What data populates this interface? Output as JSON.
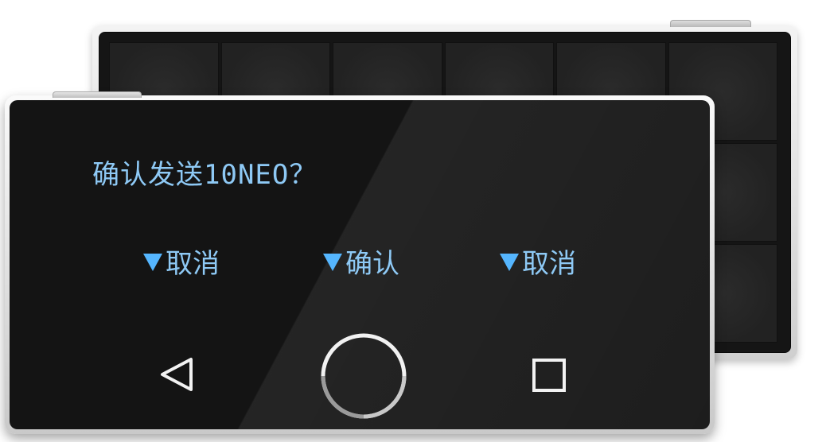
{
  "screen": {
    "prompt": "确认发送10NEO？"
  },
  "softkeys": {
    "left_label": "取消",
    "center_label": "确认",
    "right_label": "取消",
    "indicator_icon": "down-triangle-icon",
    "indicator_color": "#55b6ff",
    "text_color": "#8ec9f5"
  },
  "navbar": {
    "back_icon": "back-triangle-icon",
    "home_icon": "home-ring-icon",
    "recent_icon": "square-icon"
  }
}
